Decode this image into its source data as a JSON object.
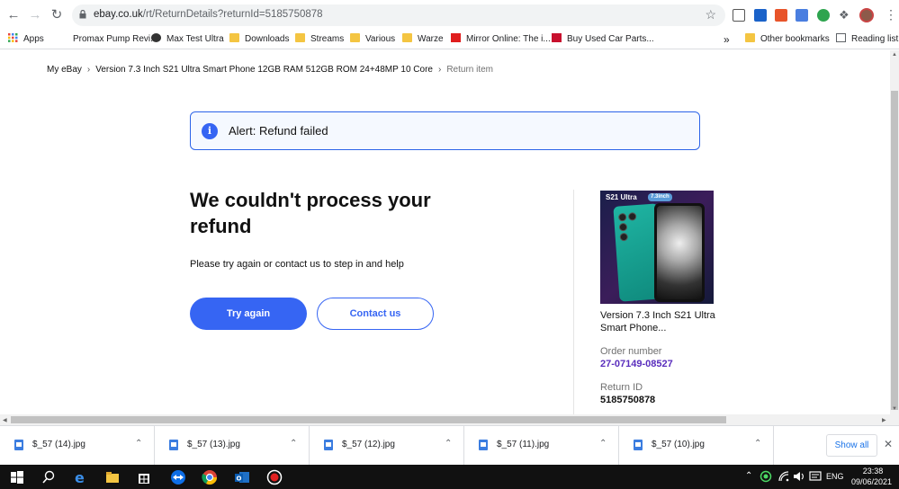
{
  "browser": {
    "url_host": "ebay.co.uk",
    "url_path": "/rt/ReturnDetails?returnId=5185750878",
    "bookmarks": [
      {
        "label": "Apps",
        "icon": "apps-grid-icon"
      },
      {
        "label": "Promax Pump Revi...",
        "icon": "page-icon"
      },
      {
        "label": "Max Test Ultra",
        "icon": "globe-icon"
      },
      {
        "label": "Downloads",
        "icon": "folder-icon"
      },
      {
        "label": "Streams",
        "icon": "folder-icon"
      },
      {
        "label": "Various",
        "icon": "folder-icon"
      },
      {
        "label": "Warze",
        "icon": "folder-icon"
      },
      {
        "label": "Mirror Online: The i...",
        "icon": "mirror-icon"
      },
      {
        "label": "Buy Used Car Parts...",
        "icon": "car-parts-icon"
      }
    ],
    "overflow_label": "»",
    "other_bookmarks": "Other bookmarks",
    "reading_list": "Reading list"
  },
  "page": {
    "breadcrumb": [
      "My eBay",
      "Version 7.3 Inch S21 Ultra Smart Phone 12GB RAM 512GB ROM 24+48MP 10 Core",
      "Return item"
    ],
    "alert_icon": "i",
    "alert_text": "Alert: Refund failed",
    "heading": "We couldn't process your refund",
    "subtext": "Please try again or contact us to step in and help",
    "try_again": "Try again",
    "contact_us": "Contact us",
    "product": {
      "image_brand": "S21 Ultra",
      "image_badge": "7.3inch",
      "title": "Version 7.3 Inch S21 Ultra Smart Phone...",
      "order_label": "Order number",
      "order_number": "27-07149-08527",
      "return_label": "Return ID",
      "return_id": "5185750878"
    }
  },
  "downloads": {
    "items": [
      "$_57 (14).jpg",
      "$_57 (13).jpg",
      "$_57 (12).jpg",
      "$_57 (11).jpg",
      "$_57 (10).jpg"
    ],
    "show_all": "Show all"
  },
  "taskbar": {
    "language": "ENG",
    "time": "23:38",
    "date": "09/06/2021"
  },
  "colors": {
    "ebay_blue": "#3665f3",
    "alert_border": "#2b63e8",
    "order_purple": "#5a2ebd"
  }
}
